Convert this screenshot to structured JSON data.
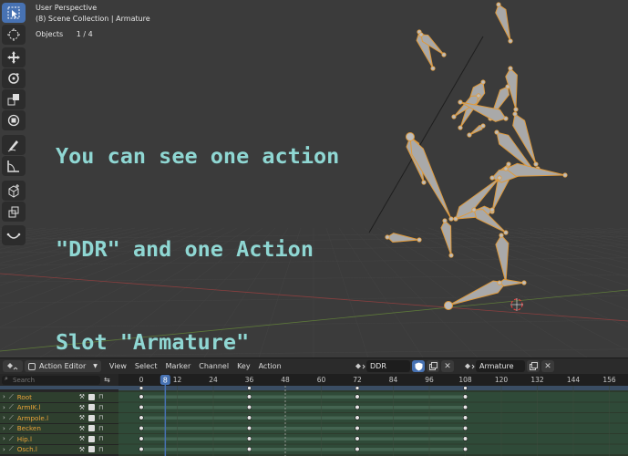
{
  "viewport": {
    "perspective": "User Perspective",
    "collection": "(8) Scene Collection | Armature",
    "objects_label": "Objects",
    "objects_count": "1 / 4",
    "caption_lines": [
      "You can see one action",
      "\"DDR\" and one Action",
      "Slot \"Armature\""
    ],
    "caption_color": "#8fd7d3"
  },
  "toolbar": {
    "tools": [
      "select-box-icon",
      "cursor-icon",
      "move-icon",
      "rotate-icon",
      "scale-icon",
      "transform-icon",
      "annotate-icon",
      "measure-icon",
      "add-cube-icon",
      "extrude-icon",
      "curve-icon"
    ],
    "active_tool": "select-box-icon"
  },
  "editor": {
    "mode": "Action Editor",
    "menus": [
      "View",
      "Select",
      "Marker",
      "Channel",
      "Key",
      "Action"
    ],
    "action_name": "DDR",
    "slot_name": "Armature",
    "search_placeholder": "Search",
    "current_frame": "8",
    "ruler_ticks": [
      "0",
      "12",
      "24",
      "36",
      "48",
      "60",
      "72",
      "84",
      "96",
      "108",
      "120",
      "132",
      "144",
      "156"
    ],
    "channels": [
      "Root",
      "ArmIK.l",
      "Armpole.l",
      "Becken",
      "Hip.l",
      "Osch.l"
    ],
    "keyframe_frames": [
      0,
      36,
      72,
      108
    ],
    "colors": {
      "accent": "#4772b3",
      "channel_text": "#e9a338",
      "bone_orange": "#e09a3a"
    }
  }
}
